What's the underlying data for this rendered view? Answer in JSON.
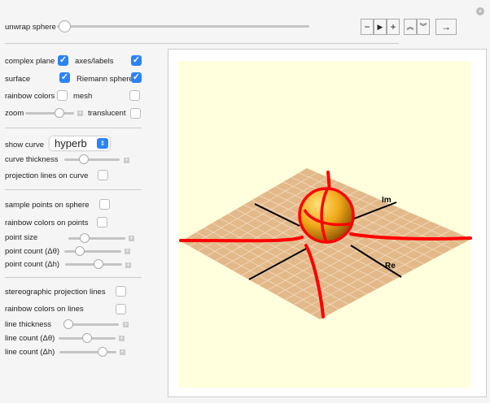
{
  "top": {
    "unwrap_label": "unwrap sphere",
    "unwrap_value": 0,
    "buttons": {
      "minus": "−",
      "play": "▶",
      "plus": "+",
      "faster": "︽",
      "slower": "︾",
      "direction": "→"
    }
  },
  "options": {
    "complex_plane": {
      "label": "complex plane",
      "checked": true
    },
    "axes_labels": {
      "label": "axes/labels",
      "checked": true
    },
    "surface": {
      "label": "surface",
      "checked": true
    },
    "riemann_sphere": {
      "label": "Riemann sphere",
      "checked": true
    },
    "rainbow_colors": {
      "label": "rainbow colors",
      "checked": false
    },
    "mesh": {
      "label": "mesh",
      "checked": false
    },
    "zoom": {
      "label": "zoom",
      "value": 0.5
    },
    "translucent": {
      "label": "translucent",
      "checked": false
    }
  },
  "curve": {
    "show_label": "show curve",
    "selected": "hyperbola",
    "selected_visible": "hyperb",
    "thickness_label": "curve thickness",
    "thickness_value": 0.3,
    "projection_label": "projection lines on curve",
    "projection_checked": false
  },
  "points": {
    "sample_label": "sample points on sphere",
    "sample_checked": false,
    "rainbow_label": "rainbow colors on points",
    "rainbow_checked": false,
    "size_label": "point size",
    "size_value": 0.3,
    "count_theta_label": "point count (Δθ)",
    "count_theta_value": 0.3,
    "count_h_label": "point count (Δh)",
    "count_h_value": 0.6
  },
  "lines": {
    "stereo_label": "stereographic projection lines",
    "stereo_checked": false,
    "rainbow_label": "rainbow colors on lines",
    "rainbow_checked": false,
    "thickness_label": "line thickness",
    "thickness_value": 0.05,
    "count_theta_label": "line count (Δθ)",
    "count_theta_value": 0.5,
    "count_h_label": "line count (Δh)",
    "count_h_value": 0.75
  },
  "plot": {
    "axis_im": "Im",
    "axis_re": "Re",
    "curve_color": "#ff0000",
    "plane_color": "#e3b98a",
    "background": "#ffffdd"
  }
}
